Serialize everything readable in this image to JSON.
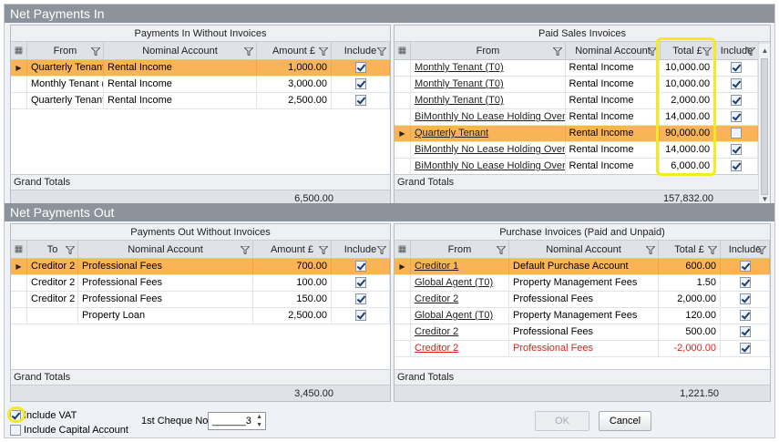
{
  "sections": {
    "in_title": "Net Payments In",
    "out_title": "Net Payments Out"
  },
  "pin": {
    "title": "Payments In Without Invoices",
    "headers": {
      "from": "From",
      "nominal": "Nominal Account",
      "amount": "Amount £",
      "include": "Include"
    },
    "rows": [
      {
        "from": "Quarterly Tenant",
        "nominal": "Rental Income",
        "amount": "1,000.00",
        "include": true,
        "selected": true
      },
      {
        "from": "Monthly Tenant (T",
        "nominal": "Rental Income",
        "amount": "3,000.00",
        "include": true,
        "selected": false
      },
      {
        "from": "Quarterly Tenant",
        "nominal": "Rental Income",
        "amount": "2,500.00",
        "include": true,
        "selected": false
      }
    ],
    "grand_totals_label": "Grand Totals",
    "total": "6,500.00"
  },
  "psi": {
    "title": "Paid Sales Invoices",
    "headers": {
      "from": "From",
      "nominal": "Nominal Account",
      "total": "Total £",
      "include": "Include"
    },
    "rows": [
      {
        "from": "Monthly Tenant (T0)",
        "nominal": "Rental Income",
        "total": "10,000.00",
        "include": true,
        "selected": false
      },
      {
        "from": "Monthly Tenant (T0)",
        "nominal": "Rental Income",
        "total": "10,000.00",
        "include": true,
        "selected": false
      },
      {
        "from": "Monthly Tenant (T0)",
        "nominal": "Rental Income",
        "total": "2,000.00",
        "include": true,
        "selected": false
      },
      {
        "from": "BiMonthly No Lease Holding Over",
        "nominal": "Rental Income",
        "total": "14,000.00",
        "include": true,
        "selected": false
      },
      {
        "from": "Quarterly Tenant",
        "nominal": "Rental Income",
        "total": "90,000.00",
        "include": false,
        "selected": true
      },
      {
        "from": "BiMonthly No Lease Holding Over",
        "nominal": "Rental Income",
        "total": "14,000.00",
        "include": true,
        "selected": false
      },
      {
        "from": "BiMonthly No Lease Holding Over",
        "nominal": "Rental Income",
        "total": "6,000.00",
        "include": true,
        "selected": false
      }
    ],
    "grand_totals_label": "Grand Totals",
    "total": "157,832.00"
  },
  "pout": {
    "title": "Payments Out Without Invoices",
    "headers": {
      "to": "To",
      "nominal": "Nominal Account",
      "amount": "Amount £",
      "include": "Include"
    },
    "rows": [
      {
        "to": "Creditor 2",
        "nominal": "Professional Fees",
        "amount": "700.00",
        "include": true,
        "selected": true
      },
      {
        "to": "Creditor 2",
        "nominal": "Professional Fees",
        "amount": "100.00",
        "include": true,
        "selected": false
      },
      {
        "to": "Creditor 2",
        "nominal": "Professional Fees",
        "amount": "150.00",
        "include": true,
        "selected": false
      },
      {
        "to": "",
        "nominal": "Property Loan",
        "amount": "2,500.00",
        "include": true,
        "selected": false
      }
    ],
    "grand_totals_label": "Grand Totals",
    "total": "3,450.00"
  },
  "pi": {
    "title": "Purchase Invoices (Paid and Unpaid)",
    "headers": {
      "from": "From",
      "nominal": "Nominal Account",
      "total": "Total £",
      "include": "Include"
    },
    "rows": [
      {
        "from": "Creditor 1",
        "nominal": "Default Purchase Account",
        "total": "600.00",
        "include": true,
        "selected": true,
        "red": false
      },
      {
        "from": "Global Agent (T0)",
        "nominal": "Property Management Fees",
        "total": "1.50",
        "include": true,
        "selected": false,
        "red": false
      },
      {
        "from": "Creditor 2",
        "nominal": "Professional Fees",
        "total": "2,000.00",
        "include": true,
        "selected": false,
        "red": false
      },
      {
        "from": "Global Agent (T0)",
        "nominal": "Property Management Fees",
        "total": "120.00",
        "include": true,
        "selected": false,
        "red": false
      },
      {
        "from": "Creditor 2",
        "nominal": "Professional Fees",
        "total": "500.00",
        "include": true,
        "selected": false,
        "red": false
      },
      {
        "from": "Creditor 2",
        "nominal": "Professional Fees",
        "total": "-2,000.00",
        "include": true,
        "selected": false,
        "red": true
      }
    ],
    "grand_totals_label": "Grand Totals",
    "total": "1,221.50"
  },
  "bottom": {
    "include_vat_label": "Include VAT",
    "include_vat": true,
    "include_capital_label": "Include Capital Account",
    "include_capital": false,
    "cheque_label": "1st Cheque No.",
    "cheque_value": "______3",
    "ok_label": "OK",
    "cancel_label": "Cancel"
  },
  "colors": {
    "selected_row": "#fbb455",
    "section_header": "#8d939b",
    "highlight": "#f3ea1f",
    "negative": "#e02020"
  }
}
